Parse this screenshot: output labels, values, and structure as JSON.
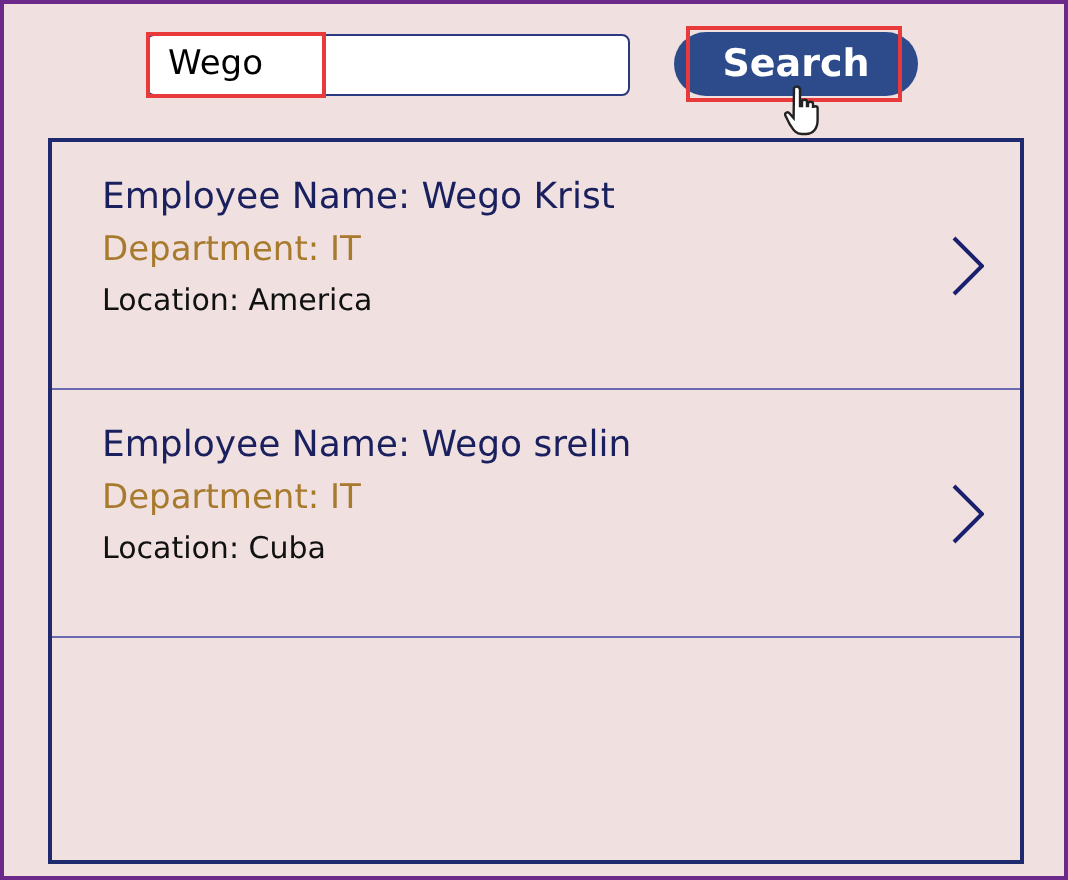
{
  "search": {
    "value": "Wego",
    "highlighted": true
  },
  "search_button": {
    "label": "Search",
    "highlighted": true
  },
  "gallery": {
    "items": [
      {
        "name": "Employee Name: Wego Krist",
        "department": "Department: IT",
        "location": "Location: America"
      },
      {
        "name": "Employee Name: Wego srelin",
        "department": "Department: IT",
        "location": "Location: Cuba"
      }
    ]
  }
}
